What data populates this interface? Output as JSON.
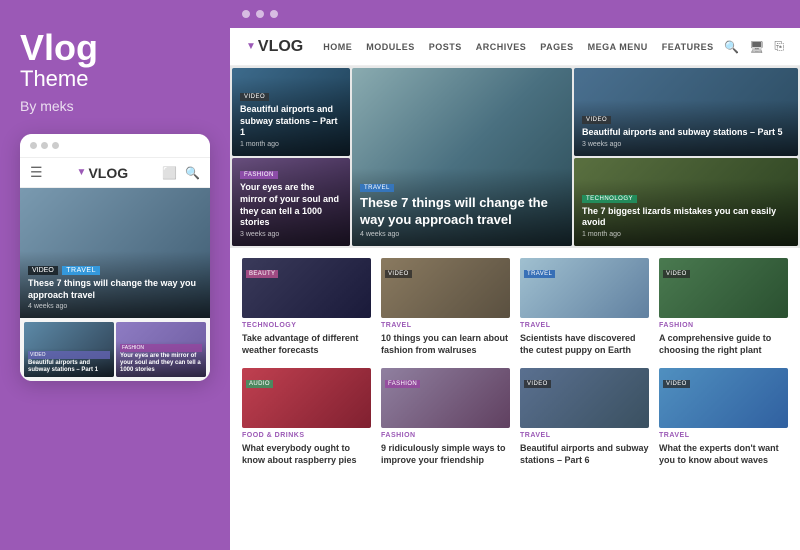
{
  "brand": {
    "title": "Vlog",
    "subtitle": "Theme",
    "author": "By meks",
    "logo": "VLOG",
    "logo_arrow": "▼"
  },
  "mobile": {
    "hero_badge_video": "VIDEO",
    "hero_badge_travel": "TRAVEL",
    "hero_title": "These 7 things will change the way you approach travel",
    "hero_date": "4 weeks ago",
    "card1_badge": "VIDEO",
    "card1_title": "Beautiful airports and subway stations – Part 1",
    "card2_badge": "FASHION",
    "card2_title": "Your eyes are the mirror of your soul and they can tell a 1000 stories"
  },
  "nav": {
    "logo": "VLOG",
    "logo_arrow": "▼",
    "items": [
      "HOME",
      "MODULES",
      "POSTS",
      "ARCHIVES",
      "PAGES",
      "MEGA MENU",
      "FEATURES"
    ]
  },
  "hero": {
    "cards": [
      {
        "badge": "VIDEO",
        "badge_type": "badge-video",
        "title": "Beautiful airports and subway stations – Part 1",
        "date": "1 month ago"
      },
      {
        "badge": "FASHION",
        "badge_type": "badge-fashion",
        "title": "Your eyes are the mirror of your soul and they can tell a 1000 stories",
        "date": "3 weeks ago"
      },
      {
        "badge": "TRAVEL",
        "badge_type": "badge-travel",
        "title": "These 7 things will change the way you approach travel",
        "date": "4 weeks ago"
      },
      {
        "badge": "VIDEO",
        "badge_type": "badge-video",
        "title": "Beautiful airports and subway stations – Part 5",
        "date": "3 weeks ago"
      },
      {
        "badge": "TECHNOLOGY",
        "badge_type": "badge-tech",
        "title": "The 7 biggest lizards mistakes you can easily avoid",
        "date": "1 month ago"
      }
    ]
  },
  "grid": {
    "row1": [
      {
        "category": "TECHNOLOGY",
        "title": "Take advantage of different weather forecasts",
        "badge": "BEAUTY",
        "badge_cls": "gb-beauty",
        "img": "img-woman-dark"
      },
      {
        "category": "TRAVEL",
        "title": "10 things you can learn about fashion from walruses",
        "badge": "VIDEO",
        "badge_cls": "gb-video",
        "img": "img-walrus"
      },
      {
        "category": "TRAVEL",
        "title": "Scientists have discovered the cutest puppy on Earth",
        "badge": "TRAVEL",
        "badge_cls": "gb-travel",
        "img": "img-puppy"
      },
      {
        "category": "FASHION",
        "title": "A comprehensive guide to choosing the right plant",
        "badge": "VIDEO",
        "badge_cls": "gb-video",
        "img": "img-succulent"
      }
    ],
    "row2": [
      {
        "category": "FOOD & DRINKS",
        "title": "What everybody ought to know about raspberry pies",
        "badge": "AUDIO",
        "badge_cls": "gb-audio",
        "img": "img-raspberries"
      },
      {
        "category": "FASHION",
        "title": "9 ridiculously simple ways to improve your friendship",
        "badge": "FASHION",
        "badge_cls": "gb-fashion",
        "img": "img-fashion2"
      },
      {
        "category": "TRAVEL",
        "title": "Beautiful airports and subway stations – Part 6",
        "badge": "VIDEO",
        "badge_cls": "gb-video",
        "img": "img-subway6"
      },
      {
        "category": "TRAVEL",
        "title": "What the experts don't want you to know about waves",
        "badge": "VIDEO",
        "badge_cls": "gb-video",
        "img": "img-waves"
      }
    ]
  }
}
